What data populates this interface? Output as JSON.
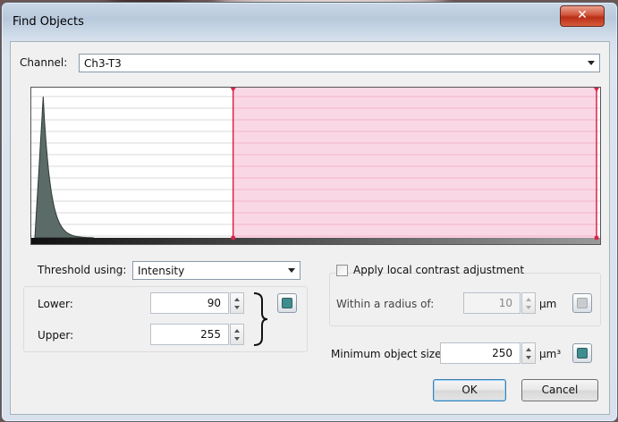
{
  "window": {
    "title": "Find Objects",
    "close_glyph": "✕"
  },
  "channel": {
    "label": "Channel:",
    "selected": "Ch3-T3"
  },
  "histogram": {
    "threshold_lower": 90,
    "threshold_upper": 255,
    "range_min": 0,
    "range_max": 255,
    "selection_color": "#f9d3e2",
    "marker_color": "#d8264b",
    "peak_color": "#5b6b67"
  },
  "threshold": {
    "using_label": "Threshold using:",
    "using_selected": "Intensity",
    "lower_label": "Lower:",
    "lower_value": "90",
    "upper_label": "Upper:",
    "upper_value": "255"
  },
  "local_contrast": {
    "checkbox_label": "Apply local contrast adjustment",
    "checked": false,
    "radius_label": "Within a radius of:",
    "radius_value": "10",
    "radius_unit": "µm"
  },
  "min_size": {
    "label": "Minimum object size:",
    "value": "250",
    "unit": "µm³"
  },
  "buttons": {
    "ok": "OK",
    "cancel": "Cancel"
  },
  "icons": {
    "close": "close-icon",
    "calculator": "calculator-icon",
    "dropdown": "chevron-down-icon",
    "spin": "spin-arrows-icon"
  }
}
